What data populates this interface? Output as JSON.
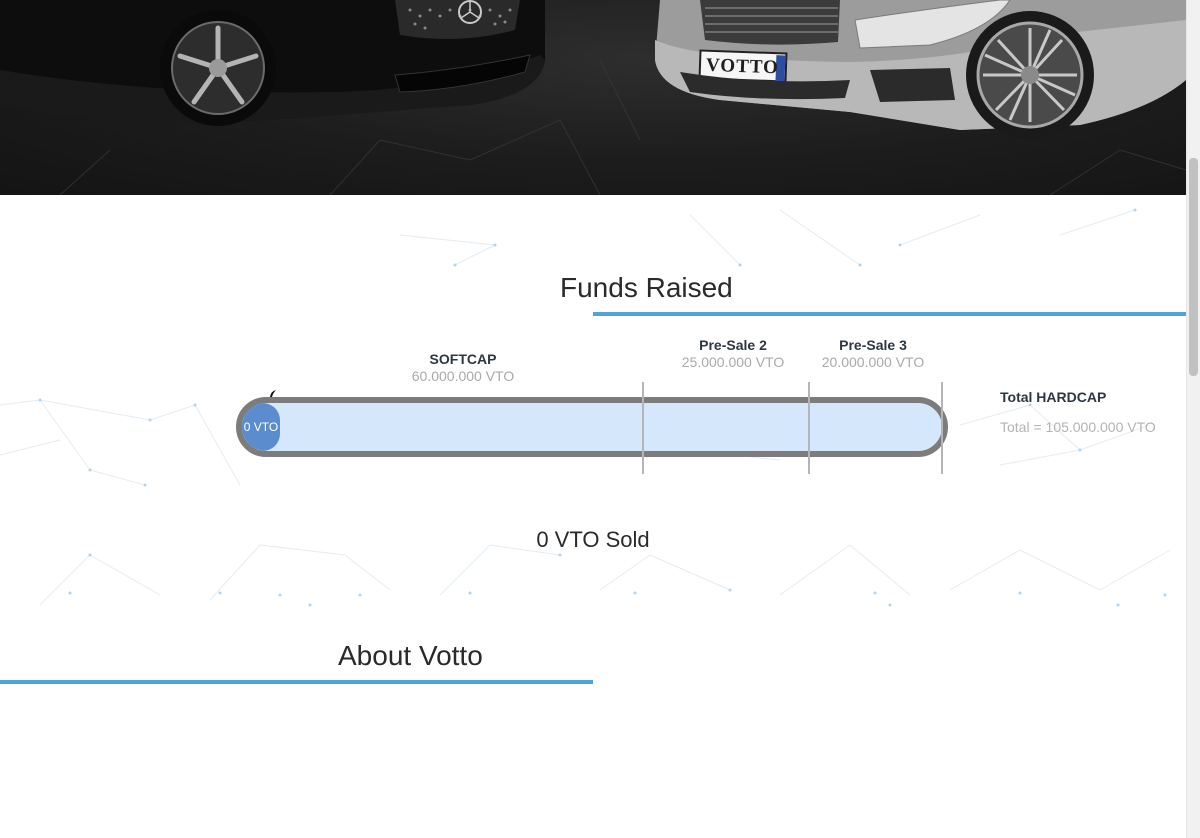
{
  "hero": {
    "plate_text": "VOTTO"
  },
  "funds": {
    "title": "Funds Raised",
    "stages": [
      {
        "name": "SOFTCAP",
        "amount": "60.000.000 VTO"
      },
      {
        "name": "Pre-Sale 2",
        "amount": "25.000.000 VTO"
      },
      {
        "name": "Pre-Sale 3",
        "amount": "20.000.000 VTO"
      }
    ],
    "progress": {
      "label": "0 VTO",
      "fraction": 0
    },
    "hardcap": {
      "title": "Total HARDCAP",
      "total": "Total = 105.000.000 VTO"
    },
    "sold": "0 VTO Sold"
  },
  "about": {
    "title": "About Votto"
  },
  "colors": {
    "accent": "#4ea3d8",
    "progress_fill": "#5b8ccd",
    "progress_track": "#d5e8fb",
    "progress_border": "#7c7c7c"
  }
}
